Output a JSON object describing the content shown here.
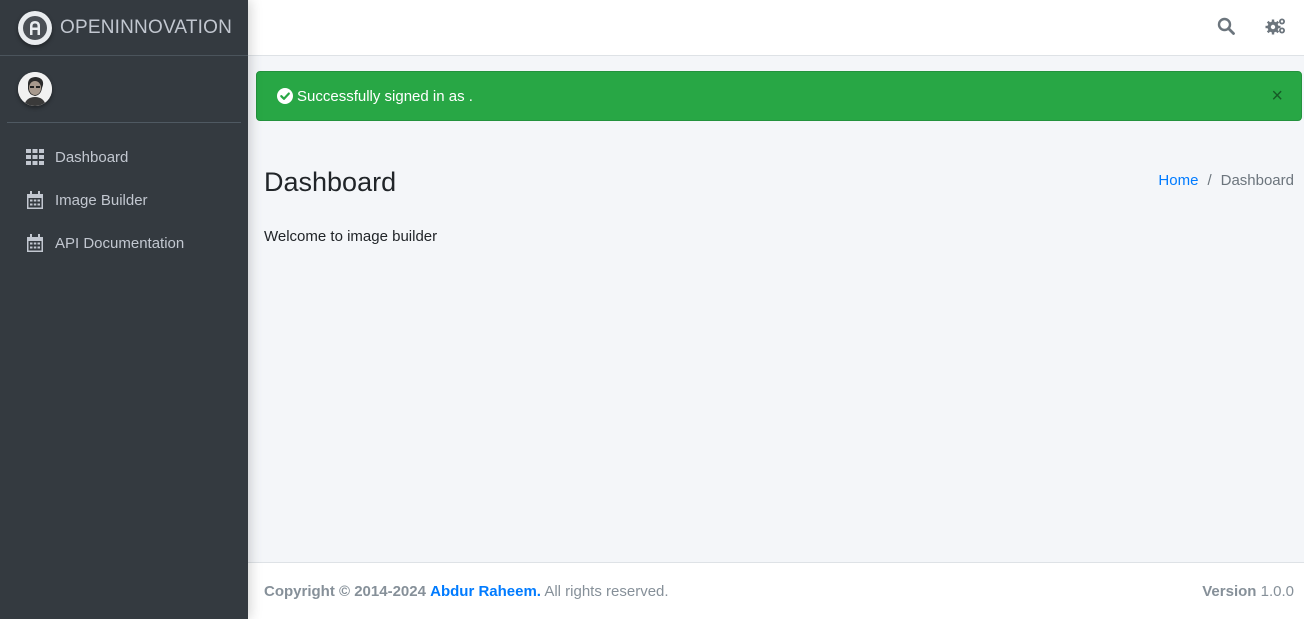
{
  "brand": {
    "name": "OPENINNOVATION",
    "logo_icon": "brand-logo-icon"
  },
  "user": {
    "avatar_icon": "user-avatar"
  },
  "sidebar": {
    "items": [
      {
        "label": "Dashboard",
        "icon": "grid-icon"
      },
      {
        "label": "Image Builder",
        "icon": "calendar-icon"
      },
      {
        "label": "API Documentation",
        "icon": "calendar-icon"
      }
    ]
  },
  "navbar": {
    "search_icon": "search-icon",
    "settings_icon": "gears-icon"
  },
  "alert": {
    "message": "Successfully signed in as .",
    "close": "×",
    "color": "#28a745"
  },
  "content": {
    "title": "Dashboard",
    "breadcrumb": {
      "home": "Home",
      "separator": "/",
      "current": "Dashboard"
    },
    "welcome": "Welcome to image builder"
  },
  "footer": {
    "copyright_prefix": "Copyright © 2014-2024",
    "author": "Abdur Raheem.",
    "rights": "All rights reserved.",
    "version_label": "Version",
    "version_value": "1.0.0"
  },
  "colors": {
    "sidebar": "#343a40",
    "link": "#007bff",
    "success": "#28a745",
    "background": "#f4f6f9"
  }
}
